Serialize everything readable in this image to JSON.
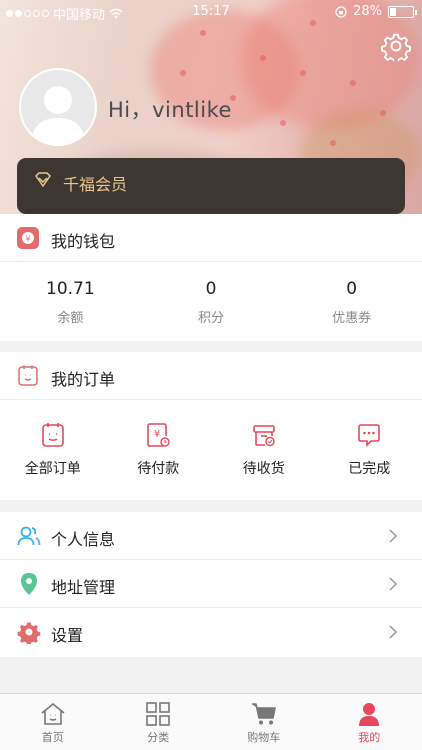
{
  "status_bar": {
    "carrier": "中国移动",
    "time": "15:17",
    "battery": "28%",
    "battery_level": 0.28
  },
  "profile": {
    "greeting": "Hi，vintlike",
    "settings_icon": "gear-icon",
    "member_label": "千福会员"
  },
  "wallet": {
    "title": "我的钱包",
    "stats": [
      {
        "value": "10.71",
        "label": "余额"
      },
      {
        "value": "0",
        "label": "积分"
      },
      {
        "value": "0",
        "label": "优惠券"
      }
    ]
  },
  "orders": {
    "title": "我的订单",
    "items": [
      {
        "label": "全部订单",
        "icon": "all-orders-icon"
      },
      {
        "label": "待付款",
        "icon": "pending-payment-icon"
      },
      {
        "label": "待收货",
        "icon": "pending-receipt-icon"
      },
      {
        "label": "已完成",
        "icon": "completed-icon"
      }
    ]
  },
  "menu": [
    {
      "label": "个人信息",
      "icon": "user-info-icon"
    },
    {
      "label": "地址管理",
      "icon": "location-pin-icon"
    },
    {
      "label": "设置",
      "icon": "gear-icon"
    }
  ],
  "tabbar": [
    {
      "label": "首页",
      "icon": "home-icon",
      "active": false
    },
    {
      "label": "分类",
      "icon": "grid-icon",
      "active": false
    },
    {
      "label": "购物车",
      "icon": "cart-icon",
      "active": false
    },
    {
      "label": "我的",
      "icon": "profile-icon",
      "active": true
    }
  ],
  "colors": {
    "accent": "#e8475b",
    "member_bg": "#3d3631",
    "member_gold": "#e9c98c",
    "location_green": "#5bc494",
    "info_blue": "#3ab4e6"
  }
}
